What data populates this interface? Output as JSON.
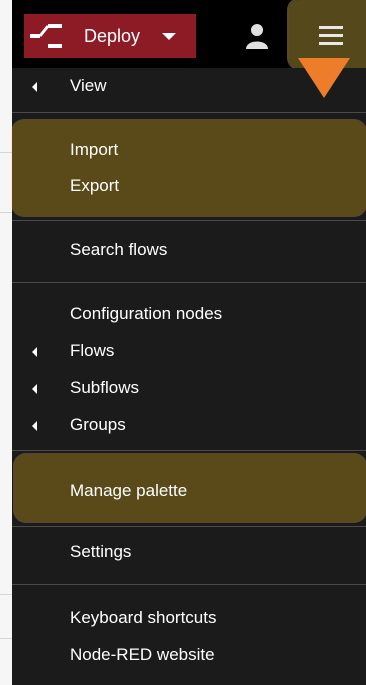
{
  "header": {
    "deploy_label": "Deploy",
    "icons": [
      "deploy-icon",
      "caret-down-icon",
      "user-icon",
      "hamburger-icon"
    ]
  },
  "menu": {
    "view": "View",
    "import": "Import",
    "export": "Export",
    "search_flows": "Search flows",
    "configuration_nodes": "Configuration nodes",
    "flows": "Flows",
    "subflows": "Subflows",
    "groups": "Groups",
    "manage_palette": "Manage palette",
    "settings": "Settings",
    "keyboard_shortcuts": "Keyboard shortcuts",
    "node_red_website": "Node-RED website"
  },
  "colors": {
    "header_bg": "#000000",
    "deploy_bg": "#8d1b26",
    "menu_bg": "#1b1b1b",
    "highlight": "#5a4a1a",
    "pointer_arrow": "#ee7d2b"
  }
}
